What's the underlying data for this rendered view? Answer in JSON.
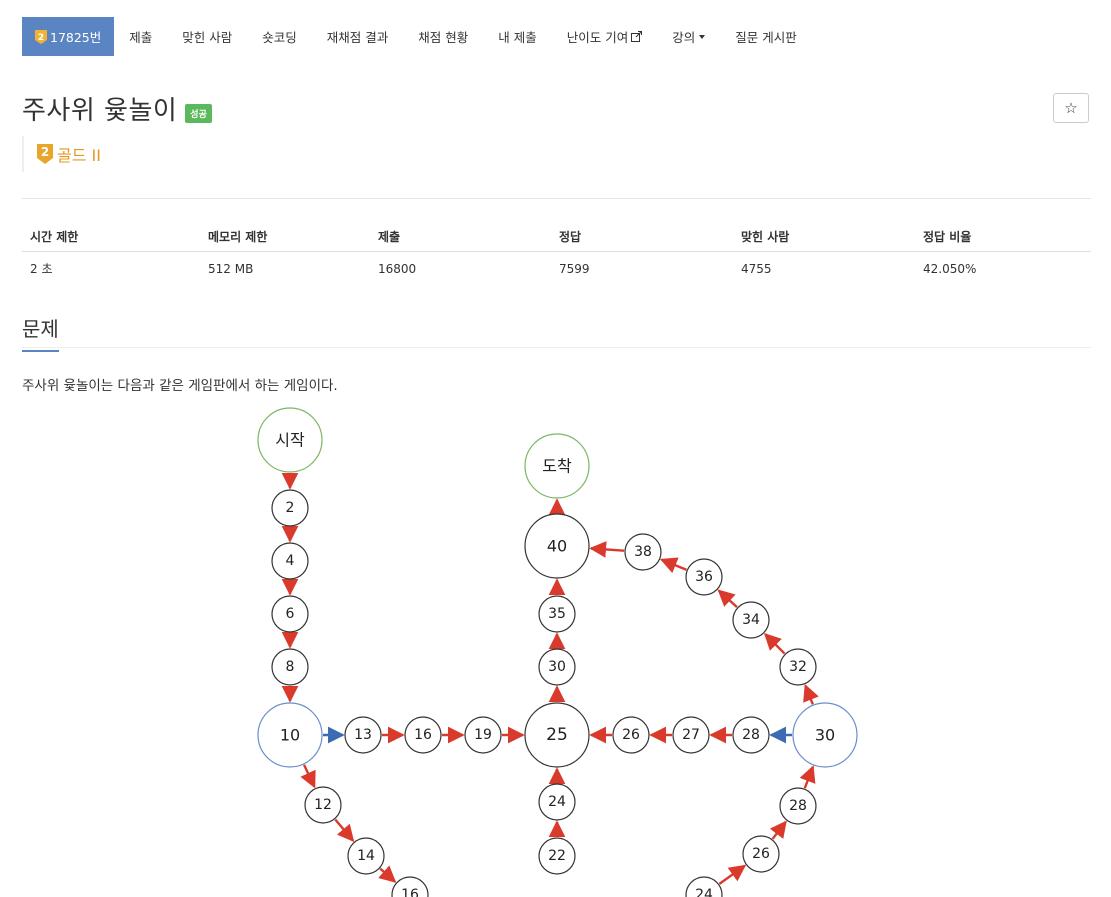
{
  "nav": {
    "problem_tab": "17825번",
    "tier_number": "2",
    "items": [
      {
        "label": "제출"
      },
      {
        "label": "맞힌 사람"
      },
      {
        "label": "숏코딩"
      },
      {
        "label": "재채점 결과"
      },
      {
        "label": "채점 현황"
      },
      {
        "label": "내 제출"
      },
      {
        "label": "난이도 기여"
      },
      {
        "label": "강의"
      },
      {
        "label": "질문 게시판"
      }
    ]
  },
  "problem": {
    "title": "주사위 윷놀이",
    "status": "성공",
    "star": "☆",
    "tier_number": "2",
    "tier_label": "골드 II"
  },
  "info": {
    "headers": [
      "시간 제한",
      "메모리 제한",
      "제출",
      "정답",
      "맞힌 사람",
      "정답 비율"
    ],
    "values": [
      "2 초",
      "512 MB",
      "16800",
      "7599",
      "4755",
      "42.050%"
    ]
  },
  "section": {
    "title": "문제",
    "text": "주사위 윷놀이는 다음과 같은 게임판에서 하는 게임이다."
  },
  "board": {
    "colors": {
      "normal_arrow": "#d93a2b",
      "blue_arrow": "#3c6ab3",
      "start_end_stroke": "#7bb661",
      "blue_node_stroke": "#6a8ccc"
    },
    "nodes": [
      {
        "label": "시작"
      },
      {
        "label": "2"
      },
      {
        "label": "4"
      },
      {
        "label": "6"
      },
      {
        "label": "8"
      },
      {
        "label": "10"
      },
      {
        "label": "12"
      },
      {
        "label": "14"
      },
      {
        "label": "16"
      },
      {
        "label": "13"
      },
      {
        "label": "16"
      },
      {
        "label": "19"
      },
      {
        "label": "25"
      },
      {
        "label": "26"
      },
      {
        "label": "27"
      },
      {
        "label": "28"
      },
      {
        "label": "30"
      },
      {
        "label": "24"
      },
      {
        "label": "22"
      },
      {
        "label": "30"
      },
      {
        "label": "35"
      },
      {
        "label": "40"
      },
      {
        "label": "도착"
      },
      {
        "label": "32"
      },
      {
        "label": "34"
      },
      {
        "label": "36"
      },
      {
        "label": "38"
      },
      {
        "label": "28"
      },
      {
        "label": "26"
      },
      {
        "label": "24"
      }
    ]
  }
}
